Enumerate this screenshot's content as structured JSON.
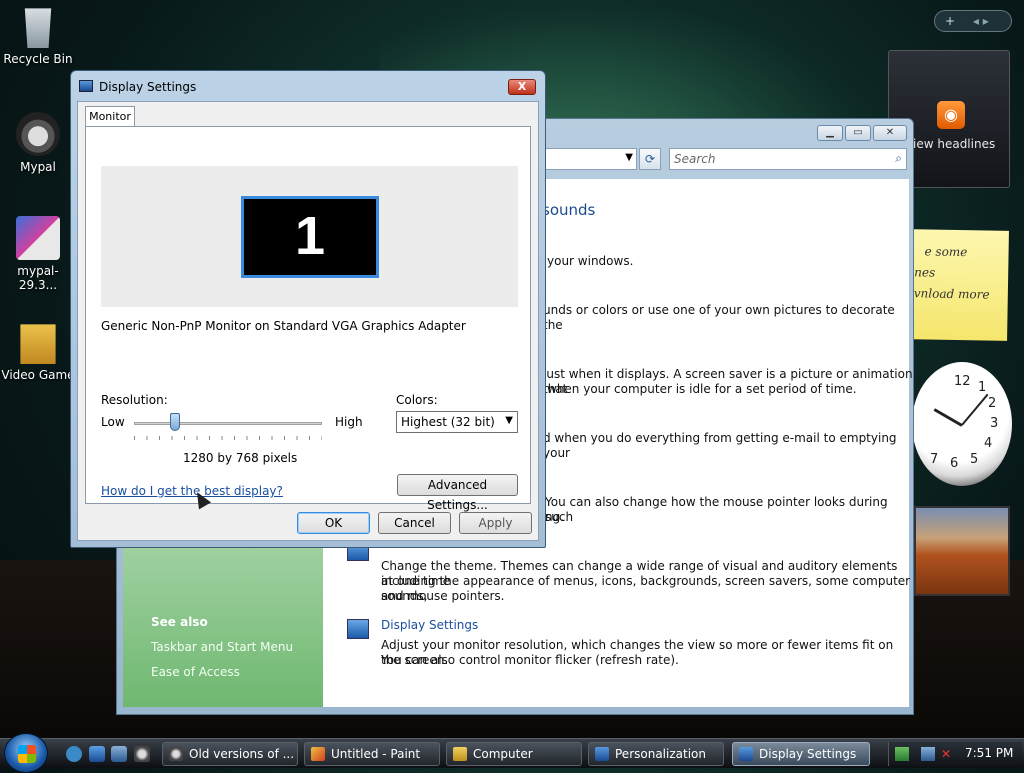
{
  "desktop": {
    "icons": [
      {
        "label": "Recycle Bin"
      },
      {
        "label": "Mypal"
      },
      {
        "label": "mypal-29.3..."
      },
      {
        "label": "Video Game"
      }
    ]
  },
  "gadgets": {
    "controls": "+",
    "headlines_label": "iew headlines",
    "note_lines": [
      "e some",
      "nes",
      "vnload more"
    ],
    "clock_numbers": [
      "12",
      "1",
      "2",
      "3",
      "4",
      "5",
      "6",
      "7"
    ]
  },
  "personalization_window": {
    "search_placeholder": "Search",
    "title_partial": "sounds",
    "texts": [
      "your windows.",
      "unds or colors or use one of your own pictures to decorate the",
      "just when it displays. A screen saver is a picture or animation that",
      "when your computer is idle for a set period of time.",
      "d when you do everything from getting e-mail to emptying your",
      "You can also change how the mouse pointer looks during such",
      "ng.",
      "Change the theme. Themes can change a wide range of visual and auditory elements at one time",
      "including the appearance of menus, icons, backgrounds, screen savers, some computer sounds,",
      "and mouse pointers."
    ],
    "display_settings_link": "Display Settings",
    "display_settings_desc1": "Adjust your monitor resolution, which changes the view so more or fewer items fit on the screen.",
    "display_settings_desc2": "You can also control monitor flicker (refresh rate).",
    "see_also": "See also",
    "see_also_links": [
      "Taskbar and Start Menu",
      "Ease of Access"
    ]
  },
  "dialog": {
    "title": "Display Settings",
    "close_label": "X",
    "tab_monitor": "Monitor",
    "monitor_number": "1",
    "monitor_name": "Generic Non-PnP Monitor on Standard VGA Graphics Adapter",
    "resolution_label": "Resolution:",
    "low_label": "Low",
    "high_label": "High",
    "resolution_value": "1280 by 768 pixels",
    "resolution_slider_fraction": 0.25,
    "colors_label": "Colors:",
    "colors_value": "Highest (32 bit)",
    "help_link": "How do I get the best display?",
    "advanced_button": "Advanced Settings...",
    "ok_button": "OK",
    "cancel_button": "Cancel",
    "apply_button": "Apply"
  },
  "taskbar": {
    "buttons": [
      {
        "label": "Old versions of ..."
      },
      {
        "label": "Untitled - Paint"
      },
      {
        "label": "Computer"
      },
      {
        "label": "Personalization"
      },
      {
        "label": "Display Settings",
        "active": true
      }
    ],
    "time": "7:51 PM"
  },
  "colors": {
    "accent": "#3a8ae0",
    "link": "#1a4fa0"
  }
}
